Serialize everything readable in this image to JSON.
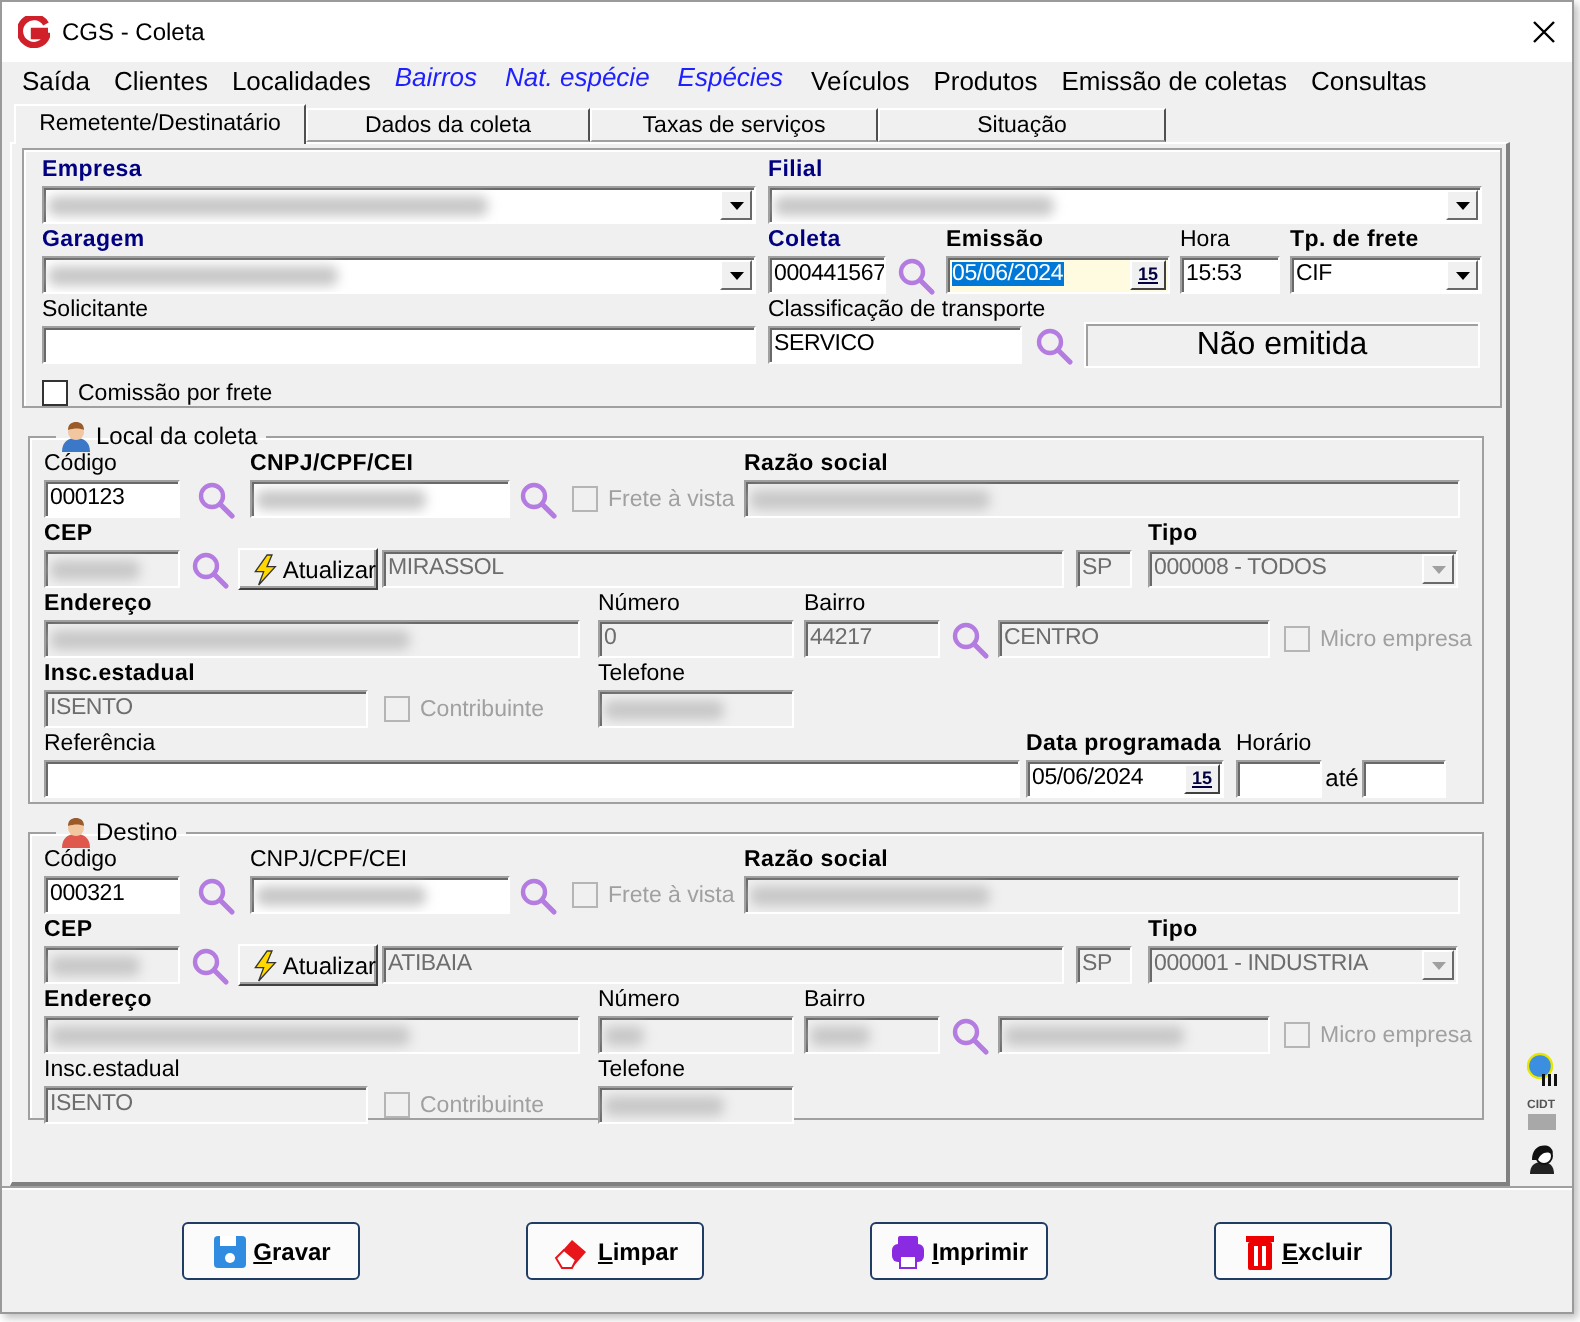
{
  "window": {
    "title": "CGS - Coleta"
  },
  "menu": [
    {
      "label": "Saída",
      "kind": "menu"
    },
    {
      "label": "Clientes",
      "kind": "menu"
    },
    {
      "label": "Localidades",
      "kind": "menu"
    },
    {
      "label": "Bairros",
      "kind": "shortcut"
    },
    {
      "label": "Nat. espécie",
      "kind": "shortcut"
    },
    {
      "label": "Espécies",
      "kind": "shortcut"
    },
    {
      "label": "Veículos",
      "kind": "menu"
    },
    {
      "label": "Produtos",
      "kind": "menu"
    },
    {
      "label": "Emissão de coletas",
      "kind": "menu"
    },
    {
      "label": "Consultas",
      "kind": "menu"
    }
  ],
  "tabs": [
    {
      "label": "Remetente/Destinatário",
      "selected": true
    },
    {
      "label": "Dados da coleta",
      "selected": false
    },
    {
      "label": "Taxas de serviços",
      "selected": false
    },
    {
      "label": "Situação",
      "selected": false
    }
  ],
  "header": {
    "empresa": {
      "label": "Empresa",
      "bold": true,
      "color": "#000080",
      "redacted": true
    },
    "filial": {
      "label": "Filial",
      "bold": true,
      "color": "#000080",
      "redacted": true
    },
    "garagem": {
      "label": "Garagem",
      "bold": true,
      "color": "#000080",
      "redacted": true
    },
    "coleta": {
      "label": "Coleta",
      "bold": true,
      "color": "#000080",
      "value": "000441567"
    },
    "emissao": {
      "label": "Emissão",
      "bold": true,
      "value": "05/06/2024",
      "highlighted": true,
      "calendar": "15"
    },
    "hora": {
      "label": "Hora",
      "bold": false,
      "value": "15:53"
    },
    "tipo_frete": {
      "label": "Tp. de frete",
      "bold": true,
      "value": "CIF"
    },
    "solicitante": {
      "label": "Solicitante",
      "bold": false
    },
    "classificacao": {
      "label": "Classificação de transporte",
      "bold": false,
      "value": "SERVICO"
    },
    "status": "Não emitida",
    "comissao": {
      "label": "Comissão por frete",
      "checked": false,
      "disabled": false
    }
  },
  "sections": [
    {
      "title": "Local da coleta",
      "kind": "origin",
      "codigo": {
        "label": "Código",
        "bold": false,
        "value": "000123"
      },
      "cnpj": {
        "label": "CNPJ/CPF/CEI",
        "bold": true,
        "redacted": true
      },
      "frete_a_vista": {
        "label": "Frete à vista",
        "checked": false,
        "disabled": true
      },
      "razao_social": {
        "label": "Razão social",
        "bold": true,
        "redacted": true,
        "disabled": true
      },
      "cep": {
        "label": "CEP",
        "bold": true,
        "redacted": true,
        "disabled": true
      },
      "atualizar": "Atualizar",
      "cidade": {
        "value": "MIRASSOL",
        "disabled": true
      },
      "uf": {
        "value": "SP",
        "disabled": true
      },
      "tipo": {
        "label": "Tipo",
        "bold": true,
        "value": "000008 - TODOS",
        "disabled": true
      },
      "endereco": {
        "label": "Endereço",
        "bold": true,
        "redacted": true,
        "disabled": true
      },
      "numero": {
        "label": "Número",
        "bold": false,
        "value": "0",
        "disabled": true
      },
      "bairro": {
        "label": "Bairro",
        "bold": false,
        "value": "44217",
        "disabled": true
      },
      "bairro_nome": {
        "value": "CENTRO",
        "disabled": true
      },
      "micro_empresa": {
        "label": "Micro empresa",
        "checked": false,
        "disabled": true
      },
      "insc_estadual": {
        "label": "Insc.estadual",
        "bold": true,
        "value": "ISENTO",
        "disabled": true
      },
      "contribuinte": {
        "label": "Contribuinte",
        "checked": false,
        "disabled": true
      },
      "telefone": {
        "label": "Telefone",
        "bold": false,
        "redacted": true,
        "disabled": true
      },
      "referencia": {
        "label": "Referência",
        "bold": false
      },
      "data_programada": {
        "label": "Data programada",
        "bold": true,
        "value": "05/06/2024",
        "calendar": "15"
      },
      "horario": {
        "label": "Horário",
        "bold": false
      },
      "ate": {
        "label": "até"
      }
    },
    {
      "title": "Destino",
      "kind": "destination",
      "codigo": {
        "label": "Código",
        "bold": false,
        "value": "000321"
      },
      "cnpj": {
        "label": "CNPJ/CPF/CEI",
        "bold": false,
        "redacted": true
      },
      "frete_a_vista": {
        "label": "Frete à vista",
        "checked": false,
        "disabled": true
      },
      "razao_social": {
        "label": "Razão social",
        "bold": true,
        "redacted": true,
        "disabled": true
      },
      "cep": {
        "label": "CEP",
        "bold": true,
        "redacted": true,
        "disabled": true
      },
      "atualizar": "Atualizar",
      "cidade": {
        "value": "ATIBAIA",
        "disabled": true
      },
      "uf": {
        "value": "SP",
        "disabled": true
      },
      "tipo": {
        "label": "Tipo",
        "bold": true,
        "value": "000001 - INDUSTRIA",
        "disabled": true
      },
      "endereco": {
        "label": "Endereço",
        "bold": true,
        "redacted": true,
        "disabled": true
      },
      "numero": {
        "label": "Número",
        "bold": false,
        "redacted": true,
        "disabled": true
      },
      "bairro": {
        "label": "Bairro",
        "bold": false,
        "redacted": true,
        "disabled": true
      },
      "bairro_nome": {
        "redacted": true,
        "disabled": true
      },
      "micro_empresa": {
        "label": "Micro empresa",
        "checked": false,
        "disabled": true
      },
      "insc_estadual": {
        "label": "Insc.estadual",
        "bold": false,
        "value": "ISENTO",
        "disabled": true
      },
      "contribuinte": {
        "label": "Contribuinte",
        "checked": false,
        "disabled": true
      },
      "telefone": {
        "label": "Telefone",
        "bold": false,
        "redacted": true,
        "disabled": true
      }
    }
  ],
  "side_tools": {
    "cidt": "CIDT"
  },
  "buttons": [
    {
      "label": "Gravar",
      "kind": "save"
    },
    {
      "label": "Limpar",
      "kind": "clear"
    },
    {
      "label": "Imprimir",
      "kind": "print"
    },
    {
      "label": "Excluir",
      "kind": "delete"
    }
  ]
}
